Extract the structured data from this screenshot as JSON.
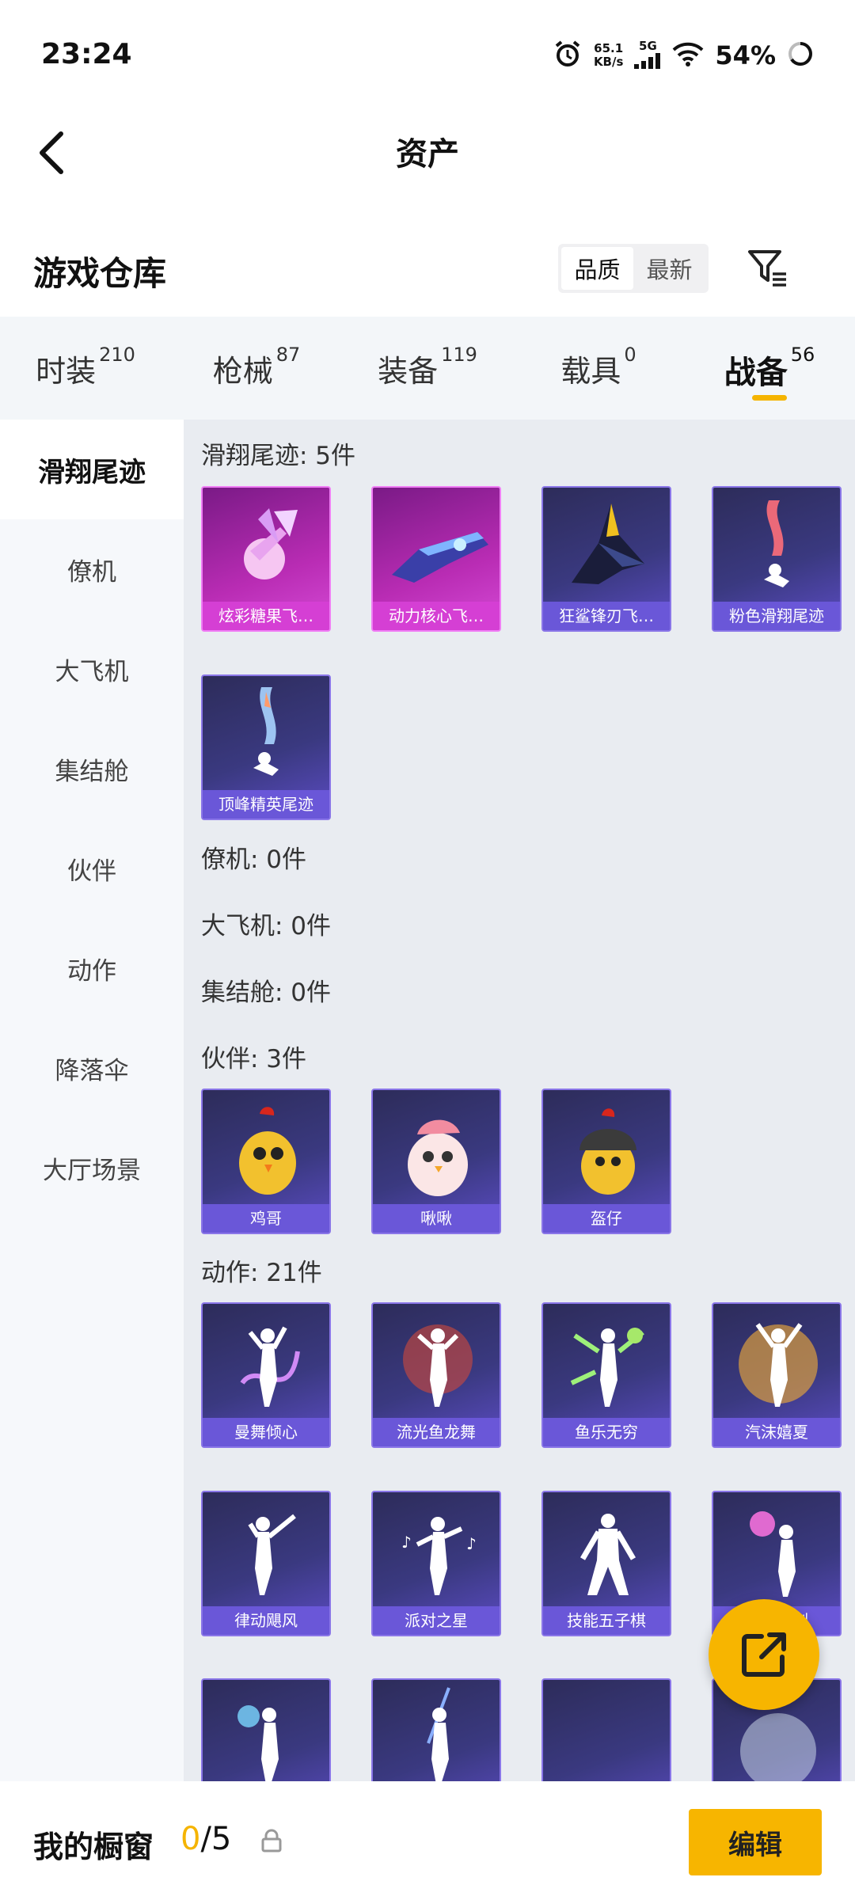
{
  "status_bar": {
    "time": "23:24",
    "net_speed_value": "65.1",
    "net_speed_unit": "KB/s",
    "network": "5G",
    "battery": "54%",
    "icons": [
      "alarm-icon",
      "signal-icon",
      "wifi-icon",
      "battery-icon"
    ]
  },
  "header": {
    "title": "资产",
    "back_icon": "chevron-left-icon"
  },
  "warehouse": {
    "title": "游戏仓库",
    "sort_options": [
      "品质",
      "最新"
    ],
    "active_sort": "品质",
    "filter_icon": "filter-icon"
  },
  "tabs": [
    {
      "label": "时装",
      "count": "210"
    },
    {
      "label": "枪械",
      "count": "87"
    },
    {
      "label": "装备",
      "count": "119"
    },
    {
      "label": "载具",
      "count": "0"
    },
    {
      "label": "战备",
      "count": "56",
      "active": true
    }
  ],
  "left_nav": [
    "滑翔尾迹",
    "僚机",
    "大飞机",
    "集结舱",
    "伙伴",
    "动作",
    "降落伞",
    "大厅场景"
  ],
  "sections": {
    "glide_trail": {
      "title": "滑翔尾迹: 5件",
      "items": [
        "炫彩糖果飞…",
        "动力核心飞…",
        "狂鲨锋刃飞…",
        "粉色滑翔尾迹",
        "顶峰精英尾迹"
      ]
    },
    "wingman": {
      "title": "僚机: 0件"
    },
    "big_plane": {
      "title": "大飞机: 0件"
    },
    "rally_pod": {
      "title": "集结舱: 0件"
    },
    "partner": {
      "title": "伙伴: 3件",
      "items": [
        "鸡哥",
        "啾啾",
        "盔仔"
      ]
    },
    "emote": {
      "title": "动作: 21件",
      "items": [
        "曼舞倾心",
        "流光鱼龙舞",
        "鱼乐无穷",
        "汽沫嬉夏",
        "律动飓风",
        "派对之星",
        "技能五子棋",
        "甜蜜时刻"
      ]
    }
  },
  "fab": {
    "icon": "share-external-icon"
  },
  "bottom_bar": {
    "label": "我的橱窗",
    "used": "0",
    "total": "/5",
    "lock_icon": "lock-icon",
    "edit_label": "编辑"
  },
  "colors": {
    "accent": "#f7b500",
    "card_purple": "#3a3980",
    "card_pink": "#b92cb4",
    "content_bg": "#e9ecf1"
  }
}
